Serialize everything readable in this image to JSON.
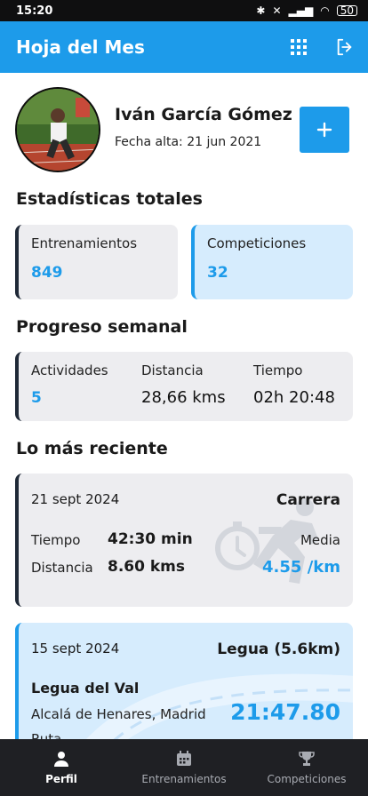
{
  "status": {
    "time": "15:20",
    "battery": "50"
  },
  "appbar": {
    "title": "Hoja del Mes"
  },
  "profile": {
    "name": "Iván García Gómez",
    "since": "Fecha alta: 21 jun 2021"
  },
  "totals": {
    "title": "Estadísticas totales",
    "trainings_label": "Entrenamientos",
    "trainings_value": "849",
    "competitions_label": "Competiciones",
    "competitions_value": "32"
  },
  "weekly": {
    "title": "Progreso semanal",
    "activities_label": "Actividades",
    "activities_value": "5",
    "distance_label": "Distancia",
    "distance_value": "28,66 kms",
    "time_label": "Tiempo",
    "time_value": "02h 20:48"
  },
  "recent": {
    "title": "Lo más reciente",
    "item1": {
      "date": "21 sept 2024",
      "type": "Carrera",
      "time_label": "Tiempo",
      "time_value": "42:30 min",
      "distance_label": "Distancia",
      "distance_value": "8.60 kms",
      "avg_label": "Media",
      "avg_value": "4.55 /km"
    },
    "item2": {
      "date": "15 sept 2024",
      "type": "Legua (5.6km)",
      "event": "Legua del Val",
      "place": "Alcalá de Henares, Madrid",
      "extra": "Ruta",
      "result": "21:47.80"
    }
  },
  "tabs": {
    "profile": "Perfil",
    "trainings": "Entrenamientos",
    "competitions": "Competiciones"
  },
  "colors": {
    "accent": "#1d9bea",
    "dark": "#1f2024"
  }
}
